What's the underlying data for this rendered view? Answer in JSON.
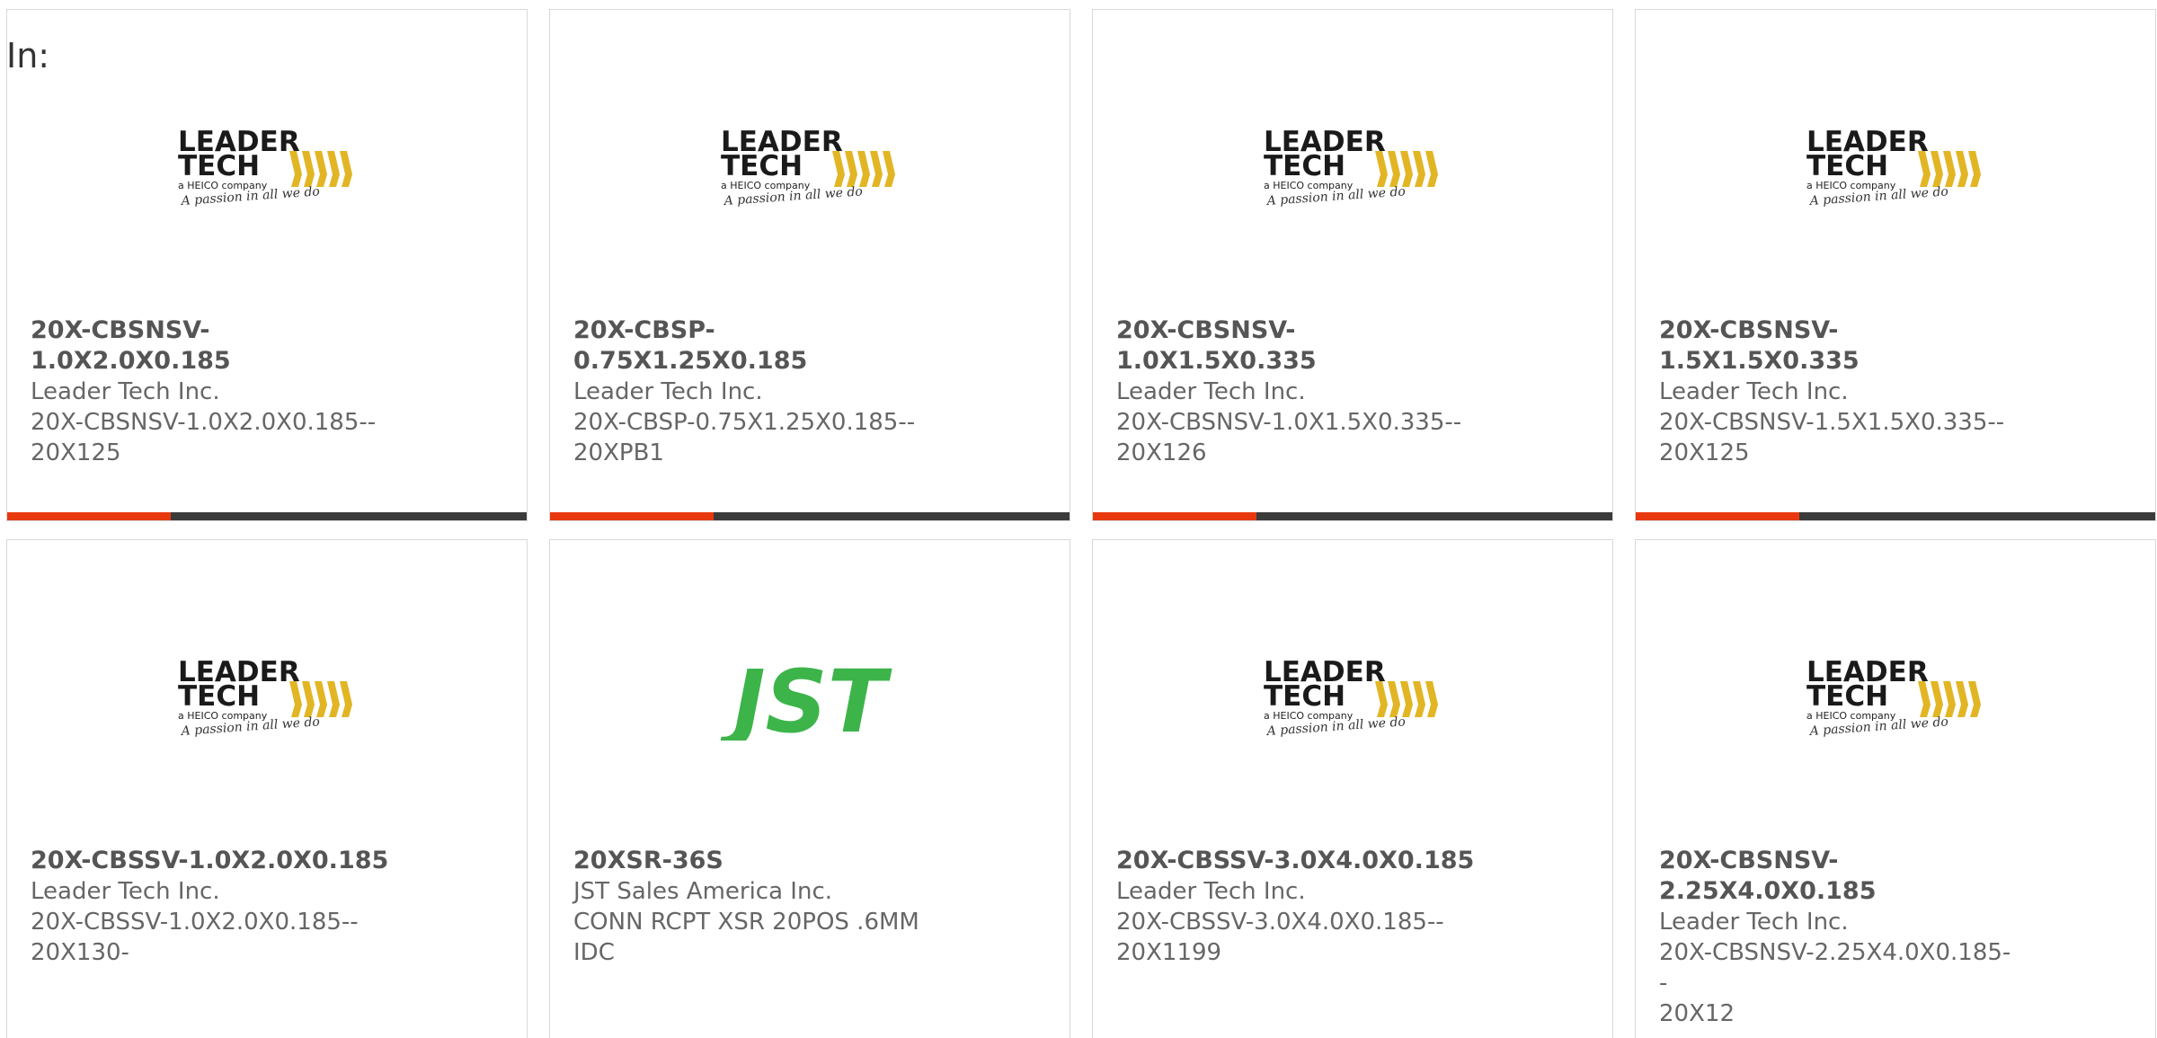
{
  "header": {
    "prefix": "In:"
  },
  "colors": {
    "accent": "#e8390e",
    "bar": "#3b3b3b",
    "jst_green": "#3cb44a",
    "lt_yellow": "#e2b524"
  },
  "logos": {
    "leader_tech": {
      "line1": "LEADER",
      "line2": "TECH",
      "tagline": "a HEICO company",
      "script": "A passion in all we do"
    },
    "jst": {
      "text": "JST"
    }
  },
  "products": [
    {
      "part": "20X-CBSNSV-1.0X2.0X0.185",
      "maker": "Leader Tech Inc.",
      "desc1": "20X-CBSNSV-1.0X2.0X0.185--",
      "desc2": "20X125",
      "logo": "leader-tech"
    },
    {
      "part": "20X-CBSP-0.75X1.25X0.185",
      "maker": "Leader Tech Inc.",
      "desc1": "20X-CBSP-0.75X1.25X0.185--",
      "desc2": "20XPB1",
      "logo": "leader-tech"
    },
    {
      "part": "20X-CBSNSV-1.0X1.5X0.335",
      "maker": "Leader Tech Inc.",
      "desc1": "20X-CBSNSV-1.0X1.5X0.335--",
      "desc2": "20X126",
      "logo": "leader-tech"
    },
    {
      "part": "20X-CBSNSV-1.5X1.5X0.335",
      "maker": "Leader Tech Inc.",
      "desc1": "20X-CBSNSV-1.5X1.5X0.335--",
      "desc2": "20X125",
      "logo": "leader-tech"
    },
    {
      "part": "20X-CBSSV-1.0X2.0X0.185",
      "maker": "Leader Tech Inc.",
      "desc1": "20X-CBSSV-1.0X2.0X0.185--",
      "desc2": "20X130-",
      "logo": "leader-tech"
    },
    {
      "part": "20XSR-36S",
      "maker": "JST Sales America Inc.",
      "desc1": "CONN RCPT XSR 20POS .6MM",
      "desc2": "IDC",
      "logo": "jst"
    },
    {
      "part": "20X-CBSSV-3.0X4.0X0.185",
      "maker": "Leader Tech Inc.",
      "desc1": "20X-CBSSV-3.0X4.0X0.185--",
      "desc2": "20X1199",
      "logo": "leader-tech"
    },
    {
      "part": "20X-CBSNSV-2.25X4.0X0.185",
      "maker": "Leader Tech Inc.",
      "desc1": "20X-CBSNSV-2.25X4.0X0.185--",
      "desc2": "20X12",
      "logo": "leader-tech"
    }
  ]
}
